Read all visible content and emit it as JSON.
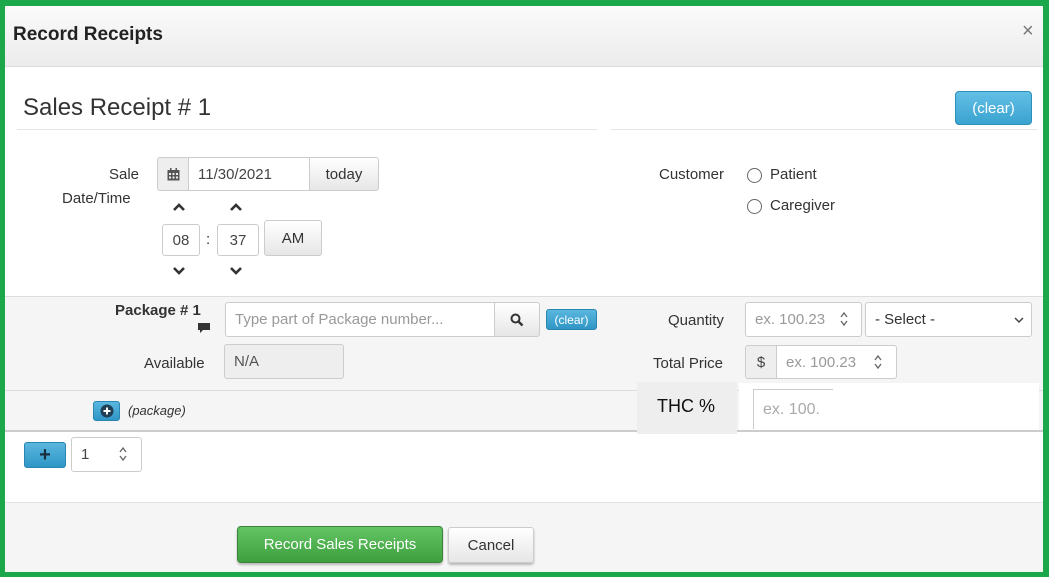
{
  "dialog": {
    "title": "Record Receipts",
    "close_glyph": "×"
  },
  "receipt": {
    "title": "Sales Receipt # 1",
    "clear_label": "(clear)"
  },
  "sale_datetime": {
    "label_line1": "Sale",
    "label_line2": "Date/Time",
    "date_value": "11/30/2021",
    "today_label": "today",
    "hour": "08",
    "minute": "37",
    "separator": ":",
    "meridiem": "AM",
    "calendar_icon": "calendar-icon"
  },
  "customer": {
    "label": "Customer",
    "options": [
      "Patient",
      "Caregiver"
    ]
  },
  "package": {
    "label": "Package # 1",
    "search_placeholder": "Type part of Package number...",
    "clear_label": "(clear)",
    "available_label": "Available",
    "available_value": "N/A",
    "add_label": "(package)"
  },
  "quantity": {
    "label": "Quantity",
    "placeholder": "ex. 100.23",
    "unit_select": "- Select -"
  },
  "total_price": {
    "label": "Total Price",
    "currency": "$",
    "placeholder": "ex. 100.23"
  },
  "thc": {
    "label": "THC %",
    "placeholder": "ex. 100."
  },
  "add_receipt": {
    "count": "1",
    "plus_glyph": "+"
  },
  "footer": {
    "submit_label": "Record Sales Receipts",
    "cancel_label": "Cancel"
  },
  "colors": {
    "frame": "#1aa84a",
    "primary_blue": "#3aa3d0",
    "success_green": "#4cae4c"
  }
}
